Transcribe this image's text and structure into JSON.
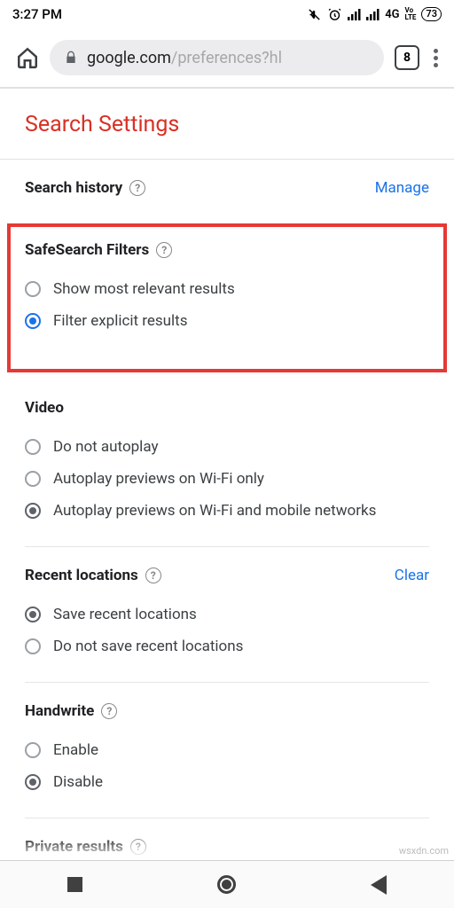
{
  "status": {
    "time": "3:27 PM",
    "network": "4G",
    "volte": "Vo LTE",
    "battery": "73"
  },
  "browser": {
    "url_host": "google.com",
    "url_path": "/preferences?hl",
    "tab_count": "8"
  },
  "page": {
    "title": "Search Settings"
  },
  "history": {
    "title": "Search history",
    "action": "Manage"
  },
  "safesearch": {
    "title": "SafeSearch Filters",
    "options": [
      {
        "label": "Show most relevant results",
        "selected": false
      },
      {
        "label": "Filter explicit results",
        "selected": true
      }
    ]
  },
  "video": {
    "title": "Video",
    "options": [
      {
        "label": "Do not autoplay",
        "selected": false
      },
      {
        "label": "Autoplay previews on Wi-Fi only",
        "selected": false
      },
      {
        "label": "Autoplay previews on Wi-Fi and mobile networks",
        "selected": true
      }
    ]
  },
  "locations": {
    "title": "Recent locations",
    "action": "Clear",
    "options": [
      {
        "label": "Save recent locations",
        "selected": true
      },
      {
        "label": "Do not save recent locations",
        "selected": false
      }
    ]
  },
  "handwrite": {
    "title": "Handwrite",
    "options": [
      {
        "label": "Enable",
        "selected": false
      },
      {
        "label": "Disable",
        "selected": true
      }
    ]
  },
  "private": {
    "title": "Private results"
  },
  "watermark": "wsxdn.com"
}
